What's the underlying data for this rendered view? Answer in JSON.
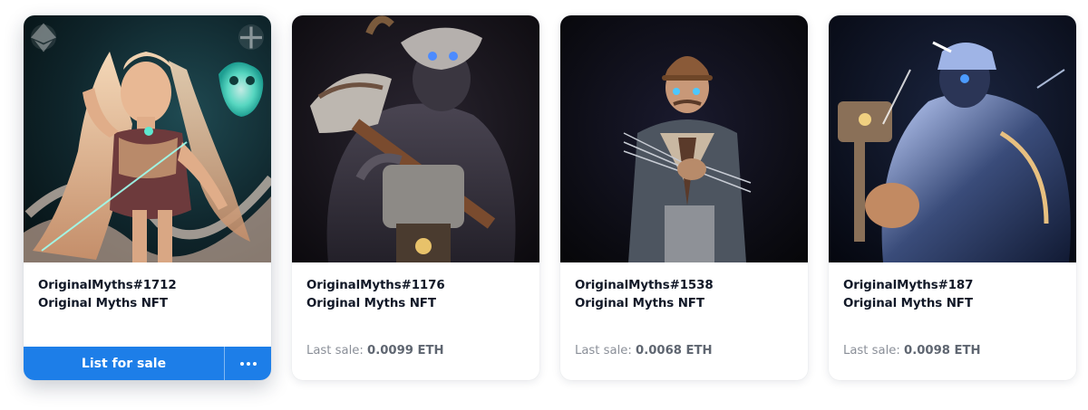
{
  "cards": [
    {
      "name": "OriginalMyths#1712",
      "collection": "Original Myths NFT",
      "action": {
        "list_label": "List for sale",
        "more_icon": "ellipsis-icon"
      },
      "overlay_icons": [
        "ethereum-icon",
        "plus-icon"
      ]
    },
    {
      "name": "OriginalMyths#1176",
      "collection": "Original Myths NFT",
      "last_sale_label": "Last sale:",
      "last_sale_value": "0.0099 ETH"
    },
    {
      "name": "OriginalMyths#1538",
      "collection": "Original Myths NFT",
      "last_sale_label": "Last sale:",
      "last_sale_value": "0.0068 ETH"
    },
    {
      "name": "OriginalMyths#187",
      "collection": "Original Myths NFT",
      "last_sale_label": "Last sale:",
      "last_sale_value": "0.0098 ETH"
    }
  ],
  "colors": {
    "accent": "#1d7ee8",
    "title": "#111827",
    "muted": "#8a8f98"
  }
}
